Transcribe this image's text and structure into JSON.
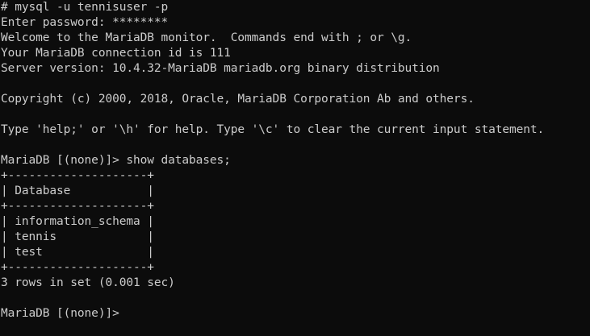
{
  "terminal": {
    "lines": [
      "# mysql -u tennisuser -p",
      "Enter password: ********",
      "Welcome to the MariaDB monitor.  Commands end with ; or \\g.",
      "Your MariaDB connection id is 111",
      "Server version: 10.4.32-MariaDB mariadb.org binary distribution",
      "",
      "Copyright (c) 2000, 2018, Oracle, MariaDB Corporation Ab and others.",
      "",
      "Type 'help;' or '\\h' for help. Type '\\c' to clear the current input statement.",
      "",
      "MariaDB [(none)]> show databases;",
      "+--------------------+",
      "| Database           |",
      "+--------------------+",
      "| information_schema |",
      "| tennis             |",
      "| test               |",
      "+--------------------+",
      "3 rows in set (0.001 sec)",
      "",
      "MariaDB [(none)]>"
    ]
  },
  "colors": {
    "background": "#0c0c0c",
    "foreground": "#cccccc"
  }
}
